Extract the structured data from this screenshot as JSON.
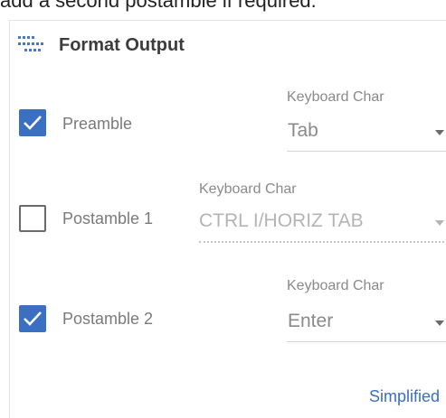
{
  "intro_text": "add a second postamble if required.",
  "header": {
    "title": "Format Output",
    "icon": "text-format-icon"
  },
  "rows": [
    {
      "label": "Preamble",
      "checked": true,
      "field_label": "Keyboard Char",
      "field_value": "Tab",
      "disabled": false
    },
    {
      "label": "Postamble 1",
      "checked": false,
      "field_label": "Keyboard Char",
      "field_value": "CTRL I/HORIZ TAB",
      "disabled": true
    },
    {
      "label": "Postamble 2",
      "checked": true,
      "field_label": "Keyboard Char",
      "field_value": "Enter",
      "disabled": false
    }
  ],
  "footer": {
    "simplified_link": "Simplified"
  },
  "colors": {
    "accent": "#3a6fc1",
    "label": "#7a7a7a",
    "disabled": "#b4b4b4"
  }
}
